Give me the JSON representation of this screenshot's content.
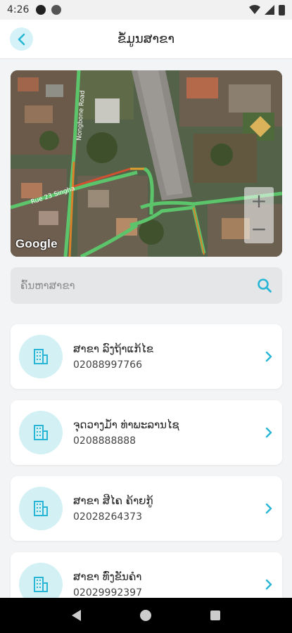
{
  "status_bar": {
    "time": "4:26"
  },
  "header": {
    "title": "ຂໍ້ມູນສາຂາ",
    "back_icon": "chevron-left-icon"
  },
  "map": {
    "attribution": "Google",
    "street_labels": [
      "Nongbone Road",
      "Rue 23 Singha"
    ],
    "zoom_in_label": "+",
    "zoom_out_label": "−"
  },
  "search": {
    "placeholder": "ຄົ້ນຫາສາຂາ",
    "value": "",
    "icon": "search-icon"
  },
  "branches": [
    {
      "name": "ສາຂາ ລົງຖ້າແກ້ໄຂ",
      "phone": "02088997766",
      "icon": "building-icon"
    },
    {
      "name": "ຈຸດວາງມ້ຳ ທ່າພະລານໄຊ",
      "phone": "0208888888",
      "icon": "building-icon"
    },
    {
      "name": "ສາຂາ ສີໄຄ ຄ້າຍກູ້",
      "phone": "02028264373",
      "icon": "building-icon"
    },
    {
      "name": "ສາຂາ ທົ່ງຂັນຄໍາ",
      "phone": "02029992397",
      "icon": "building-icon"
    }
  ],
  "colors": {
    "accent": "#29b6d6",
    "accent_light": "#d3f1f5"
  }
}
